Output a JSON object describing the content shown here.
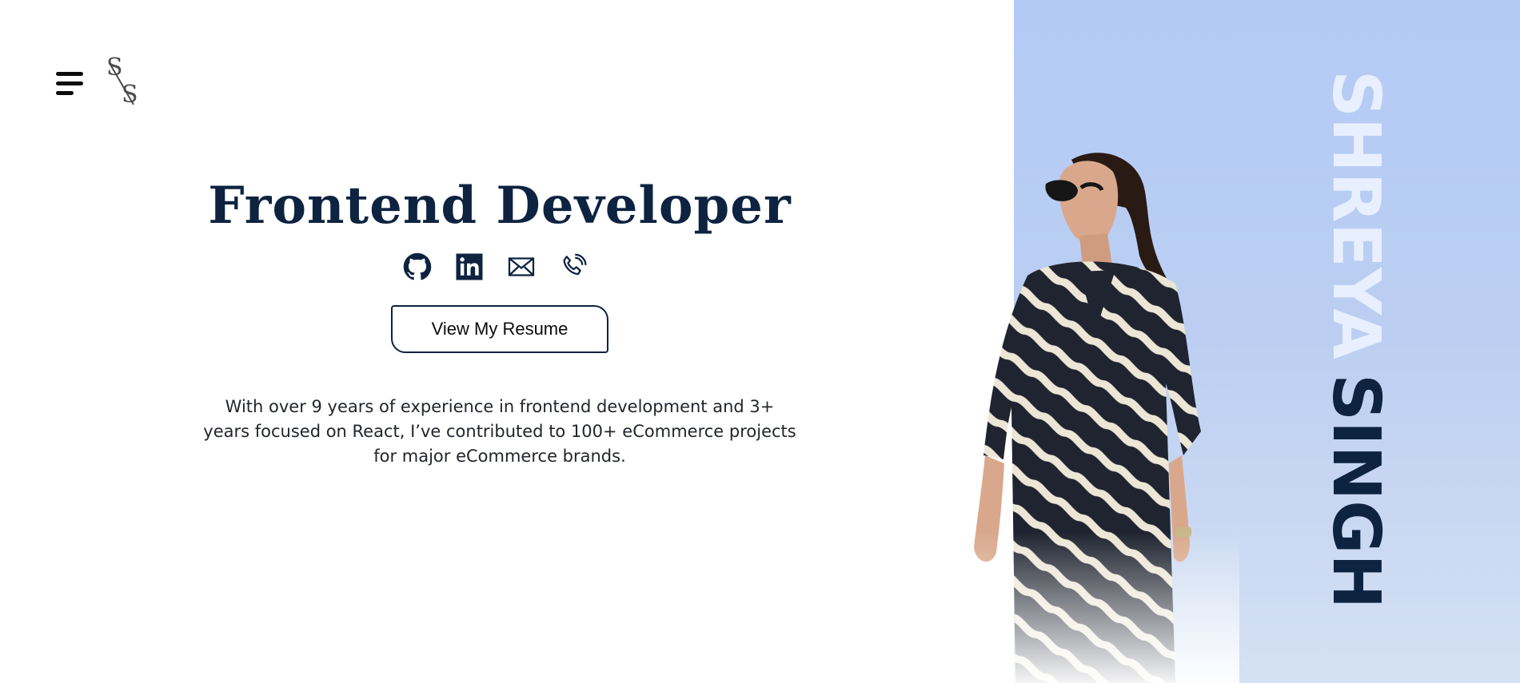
{
  "header": {
    "menu_icon": "hamburger-menu-icon",
    "logo": {
      "letter_top": "S",
      "letter_bottom": "S"
    }
  },
  "hero": {
    "title": "Frontend Developer",
    "social_links": [
      {
        "name": "github",
        "icon": "github-icon"
      },
      {
        "name": "linkedin",
        "icon": "linkedin-icon"
      },
      {
        "name": "email",
        "icon": "mail-icon"
      },
      {
        "name": "phone",
        "icon": "phone-icon"
      }
    ],
    "resume_button": "View My Resume",
    "bio": "With over 9 years of experience in frontend development and 3+ years focused on React, I’ve contributed to 100+ eCommerce projects for major eCommerce brands."
  },
  "side_panel": {
    "first_name": "SHREYA",
    "last_name": "SINGH",
    "photo": "portrait-photo"
  },
  "colors": {
    "navy": "#0d2340",
    "panel_blue": "#b3caf5",
    "name_light": "#e8efff"
  }
}
